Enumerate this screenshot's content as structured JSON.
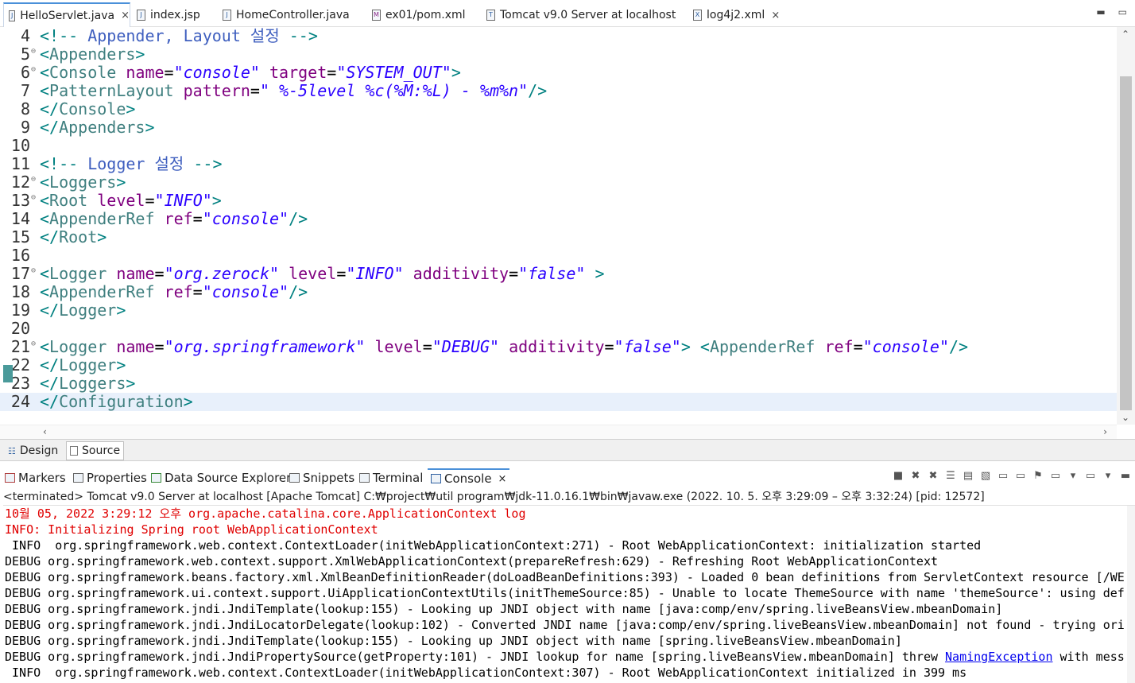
{
  "tabs": [
    {
      "label": "HelloServlet.java",
      "icon": "J",
      "close": "×"
    },
    {
      "label": "index.jsp",
      "icon": "J"
    },
    {
      "label": "HomeController.java",
      "icon": "J"
    },
    {
      "label": "ex01/pom.xml",
      "icon": "M"
    },
    {
      "label": "Tomcat v9.0 Server at localhost",
      "icon": "T"
    },
    {
      "label": "log4j2.xml",
      "icon": "X",
      "close": "×"
    }
  ],
  "editor": {
    "lines": [
      {
        "num": "4",
        "fold": false,
        "parts": [
          [
            "bracket",
            "<!-- "
          ],
          [
            "comment",
            "Appender, Layout 설정 "
          ],
          [
            "bracket",
            "-->"
          ]
        ]
      },
      {
        "num": "5",
        "fold": true,
        "parts": [
          [
            "bracket",
            "<"
          ],
          [
            "tagname",
            "Appenders"
          ],
          [
            "bracket",
            ">"
          ]
        ]
      },
      {
        "num": "6",
        "fold": true,
        "parts": [
          [
            "bracket",
            "<"
          ],
          [
            "tagname",
            "Console "
          ],
          [
            "attr",
            "name"
          ],
          [
            "eq",
            "="
          ],
          [
            "val",
            "\"console\""
          ],
          [
            "attr",
            " target"
          ],
          [
            "eq",
            "="
          ],
          [
            "val",
            "\"SYSTEM_OUT\""
          ],
          [
            "bracket",
            ">"
          ]
        ]
      },
      {
        "num": "7",
        "fold": false,
        "parts": [
          [
            "bracket",
            "<"
          ],
          [
            "tagname",
            "PatternLayout "
          ],
          [
            "attr",
            "pattern"
          ],
          [
            "eq",
            "="
          ],
          [
            "val",
            "\" %-5level %c(%M:%L) - %m%n\""
          ],
          [
            "bracket",
            "/>"
          ]
        ]
      },
      {
        "num": "8",
        "fold": false,
        "parts": [
          [
            "bracket",
            "</"
          ],
          [
            "tagname",
            "Console"
          ],
          [
            "bracket",
            ">"
          ]
        ]
      },
      {
        "num": "9",
        "fold": false,
        "parts": [
          [
            "bracket",
            "</"
          ],
          [
            "tagname",
            "Appenders"
          ],
          [
            "bracket",
            ">"
          ]
        ]
      },
      {
        "num": "10",
        "fold": false,
        "parts": []
      },
      {
        "num": "11",
        "fold": false,
        "parts": [
          [
            "bracket",
            "<!-- "
          ],
          [
            "comment",
            "Logger 설정 "
          ],
          [
            "bracket",
            "-->"
          ]
        ]
      },
      {
        "num": "12",
        "fold": true,
        "parts": [
          [
            "bracket",
            "<"
          ],
          [
            "tagname",
            "Loggers"
          ],
          [
            "bracket",
            ">"
          ]
        ]
      },
      {
        "num": "13",
        "fold": true,
        "parts": [
          [
            "bracket",
            "<"
          ],
          [
            "tagname",
            "Root "
          ],
          [
            "attr",
            "level"
          ],
          [
            "eq",
            "="
          ],
          [
            "val",
            "\"INFO\""
          ],
          [
            "bracket",
            ">"
          ]
        ]
      },
      {
        "num": "14",
        "fold": false,
        "parts": [
          [
            "bracket",
            "<"
          ],
          [
            "tagname",
            "AppenderRef "
          ],
          [
            "attr",
            "ref"
          ],
          [
            "eq",
            "="
          ],
          [
            "val",
            "\"console\""
          ],
          [
            "bracket",
            "/>"
          ]
        ]
      },
      {
        "num": "15",
        "fold": false,
        "parts": [
          [
            "bracket",
            "</"
          ],
          [
            "tagname",
            "Root"
          ],
          [
            "bracket",
            ">"
          ]
        ]
      },
      {
        "num": "16",
        "fold": false,
        "parts": []
      },
      {
        "num": "17",
        "fold": true,
        "parts": [
          [
            "bracket",
            "<"
          ],
          [
            "tagname",
            "Logger "
          ],
          [
            "attr",
            "name"
          ],
          [
            "eq",
            "="
          ],
          [
            "val",
            "\"org.zerock\""
          ],
          [
            "attr",
            " level"
          ],
          [
            "eq",
            "="
          ],
          [
            "val",
            "\"INFO\""
          ],
          [
            "attr",
            " additivity"
          ],
          [
            "eq",
            "="
          ],
          [
            "val",
            "\"false\""
          ],
          [
            "bracket",
            " >"
          ]
        ]
      },
      {
        "num": "18",
        "fold": false,
        "parts": [
          [
            "bracket",
            "<"
          ],
          [
            "tagname",
            "AppenderRef "
          ],
          [
            "attr",
            "ref"
          ],
          [
            "eq",
            "="
          ],
          [
            "val",
            "\"console\""
          ],
          [
            "bracket",
            "/>"
          ]
        ]
      },
      {
        "num": "19",
        "fold": false,
        "parts": [
          [
            "bracket",
            "</"
          ],
          [
            "tagname",
            "Logger"
          ],
          [
            "bracket",
            ">"
          ]
        ]
      },
      {
        "num": "20",
        "fold": false,
        "parts": []
      },
      {
        "num": "21",
        "fold": true,
        "parts": [
          [
            "bracket",
            "<"
          ],
          [
            "tagname",
            "Logger "
          ],
          [
            "attr",
            "name"
          ],
          [
            "eq",
            "="
          ],
          [
            "val",
            "\"org.springframework\""
          ],
          [
            "attr",
            " level"
          ],
          [
            "eq",
            "="
          ],
          [
            "val",
            "\"DEBUG\""
          ],
          [
            "attr",
            " additivity"
          ],
          [
            "eq",
            "="
          ],
          [
            "val",
            "\"false\""
          ],
          [
            "bracket",
            ">"
          ],
          [
            "eq",
            " "
          ],
          [
            "bracket",
            "<"
          ],
          [
            "tagname",
            "AppenderRef "
          ],
          [
            "attr",
            "ref"
          ],
          [
            "eq",
            "="
          ],
          [
            "val",
            "\"console\""
          ],
          [
            "bracket",
            "/>"
          ]
        ]
      },
      {
        "num": "22",
        "fold": false,
        "parts": [
          [
            "bracket",
            "</"
          ],
          [
            "tagname",
            "Logger"
          ],
          [
            "bracket",
            ">"
          ]
        ]
      },
      {
        "num": "23",
        "fold": false,
        "parts": [
          [
            "bracket",
            "</"
          ],
          [
            "tagname",
            "Loggers"
          ],
          [
            "bracket",
            ">"
          ]
        ]
      },
      {
        "num": "24",
        "fold": false,
        "current": true,
        "parts": [
          [
            "bracket",
            "</"
          ],
          [
            "tagname",
            "Configuration"
          ],
          [
            "bracket",
            ">"
          ]
        ]
      }
    ]
  },
  "bottom_tabs": {
    "design": "Design",
    "source": "Source"
  },
  "views": [
    {
      "label": "Markers"
    },
    {
      "label": "Properties"
    },
    {
      "label": "Data Source Explorer"
    },
    {
      "label": "Snippets"
    },
    {
      "label": "Terminal"
    },
    {
      "label": "Console",
      "selected": true,
      "close": "×"
    }
  ],
  "console": {
    "header": "<terminated> Tomcat v9.0 Server at localhost [Apache Tomcat] C:₩project₩util program₩jdk-11.0.16.1₩bin₩javaw.exe  (2022. 10. 5. 오후 3:29:09 – 오후 3:32:24) [pid: 12572]",
    "lines": [
      {
        "text": "10월 05, 2022 3:29:12 오후 org.apache.catalina.core.ApplicationContext log",
        "red": true
      },
      {
        "text": "INFO: Initializing Spring root WebApplicationContext",
        "red": true
      },
      {
        "text": " INFO  org.springframework.web.context.ContextLoader(initWebApplicationContext:271) - Root WebApplicationContext: initialization started"
      },
      {
        "text": "DEBUG org.springframework.web.context.support.XmlWebApplicationContext(prepareRefresh:629) - Refreshing Root WebApplicationContext"
      },
      {
        "text": "DEBUG org.springframework.beans.factory.xml.XmlBeanDefinitionReader(doLoadBeanDefinitions:393) - Loaded 0 bean definitions from ServletContext resource [/WE"
      },
      {
        "text": "DEBUG org.springframework.ui.context.support.UiApplicationContextUtils(initThemeSource:85) - Unable to locate ThemeSource with name 'themeSource': using def"
      },
      {
        "text": "DEBUG org.springframework.jndi.JndiTemplate(lookup:155) - Looking up JNDI object with name [java:comp/env/spring.liveBeansView.mbeanDomain]"
      },
      {
        "text": "DEBUG org.springframework.jndi.JndiLocatorDelegate(lookup:102) - Converted JNDI name [java:comp/env/spring.liveBeansView.mbeanDomain] not found - trying ori"
      },
      {
        "text": "DEBUG org.springframework.jndi.JndiTemplate(lookup:155) - Looking up JNDI object with name [spring.liveBeansView.mbeanDomain]"
      },
      {
        "text": "DEBUG org.springframework.jndi.JndiPropertySource(getProperty:101) - JNDI lookup for name [spring.liveBeansView.mbeanDomain] threw ",
        "link": "NamingException",
        "after": " with mess"
      },
      {
        "text": " INFO  org.springframework.web.context.ContextLoader(initWebApplicationContext:307) - Root WebApplicationContext initialized in 399 ms"
      }
    ]
  },
  "icons": {
    "minimize": "minimize-icon",
    "maximize": "maximize-icon"
  }
}
